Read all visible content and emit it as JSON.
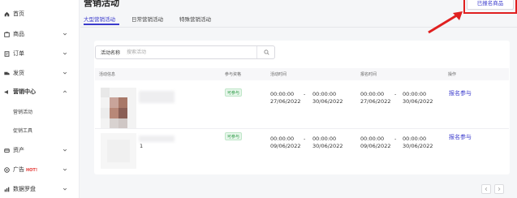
{
  "sidebar": {
    "items": [
      {
        "label": "首页",
        "icon": "home-icon",
        "expandable": false
      },
      {
        "label": "商品",
        "icon": "goods-icon",
        "expandable": true
      },
      {
        "label": "订单",
        "icon": "order-icon",
        "expandable": true
      },
      {
        "label": "发货",
        "icon": "shipping-icon",
        "expandable": true
      },
      {
        "label": "营销中心",
        "icon": "marketing-icon",
        "expandable": true,
        "expanded": true,
        "children": [
          {
            "label": "营销活动"
          },
          {
            "label": "促销工具"
          }
        ]
      },
      {
        "label": "资产",
        "icon": "assets-icon",
        "expandable": true
      },
      {
        "label": "广告",
        "icon": "ad-icon",
        "badge": "HOT!",
        "expandable": true
      },
      {
        "label": "数据罗盘",
        "icon": "data-compass-icon",
        "expandable": true
      }
    ]
  },
  "header": {
    "title": "营销活动",
    "registered_button": "已报名商品",
    "tabs": [
      {
        "label": "大型营销活动",
        "active": true
      },
      {
        "label": "日常营销活动",
        "active": false
      },
      {
        "label": "特殊营销活动",
        "active": false
      }
    ]
  },
  "search": {
    "label": "活动名称",
    "placeholder": "搜索活动",
    "value": ""
  },
  "table": {
    "columns": [
      "活动信息",
      "参与资格",
      "活动时间",
      "报名时间",
      "操作"
    ],
    "rows": [
      {
        "eligibility": "可参与",
        "activity_start_time": "00:00:00",
        "activity_start_date": "27/06/2022",
        "activity_end_time": "00:00:00",
        "activity_end_date": "30/06/2022",
        "signup_start_time": "00:00:00",
        "signup_start_date": "27/06/2022",
        "signup_end_time": "00:00:00",
        "signup_end_date": "30/06/2022",
        "action": "报名参与"
      },
      {
        "info_digit": "1",
        "eligibility": "可参与",
        "activity_start_time": "00:00:00",
        "activity_start_date": "09/06/2022",
        "activity_end_time": "00:00:00",
        "activity_end_date": "30/06/2022",
        "signup_start_time": "00:00:00",
        "signup_start_date": "09/06/2022",
        "signup_end_time": "00:00:00",
        "signup_end_date": "30/06/2022",
        "action": "报名参与"
      }
    ],
    "range_separator": "-"
  },
  "colors": {
    "accent": "#3b3bcc",
    "eligible": "#2e9b47",
    "highlight": "#e02020"
  }
}
